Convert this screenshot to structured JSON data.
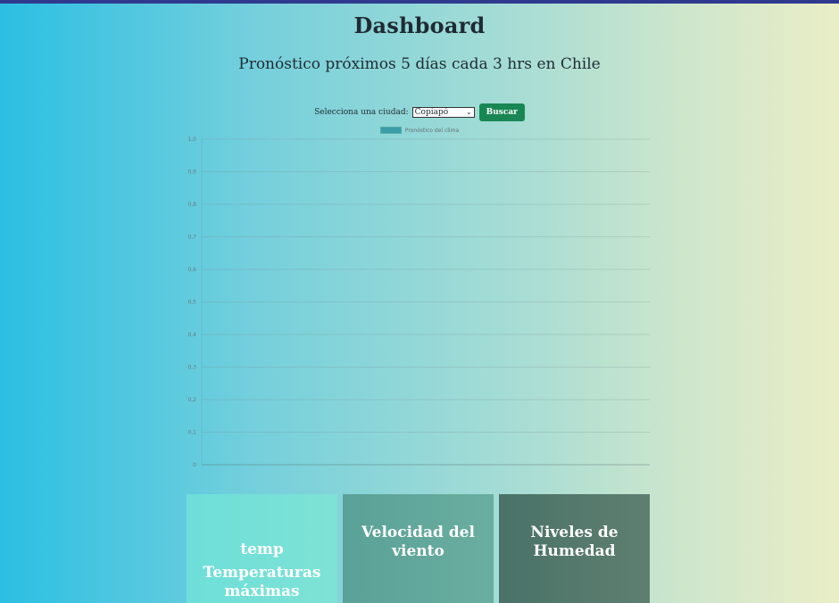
{
  "header": {
    "title": "Dashboard",
    "subtitle": "Pronóstico próximos 5 días cada 3 hrs en Chile"
  },
  "controls": {
    "select_label": "Selecciona una ciudad:",
    "selected_city": "Copiapó",
    "search_button": "Buscar"
  },
  "chart_data": {
    "type": "bar",
    "legend": [
      {
        "name": "Pronóstico del clima",
        "color": "#3a9da7"
      }
    ],
    "legend_position": "top-center",
    "y_ticks": [
      "1,0",
      "0,9",
      "0,8",
      "0,7",
      "0,6",
      "0,5",
      "0,4",
      "0,3",
      "0,2",
      "0,1",
      "0"
    ],
    "ylim": [
      0,
      1
    ],
    "grid": true,
    "series": []
  },
  "cards": [
    {
      "line1": "temp",
      "line2": "Temperaturas máximas"
    },
    {
      "line1": "Velocidad del viento"
    },
    {
      "line1": "Niveles de Humedad"
    }
  ],
  "colors": {
    "top_bar": "#2f3a8f",
    "button": "#198754",
    "card1": "#6ddfd8",
    "card2": "#5aa197",
    "card3": "#4a7268"
  }
}
